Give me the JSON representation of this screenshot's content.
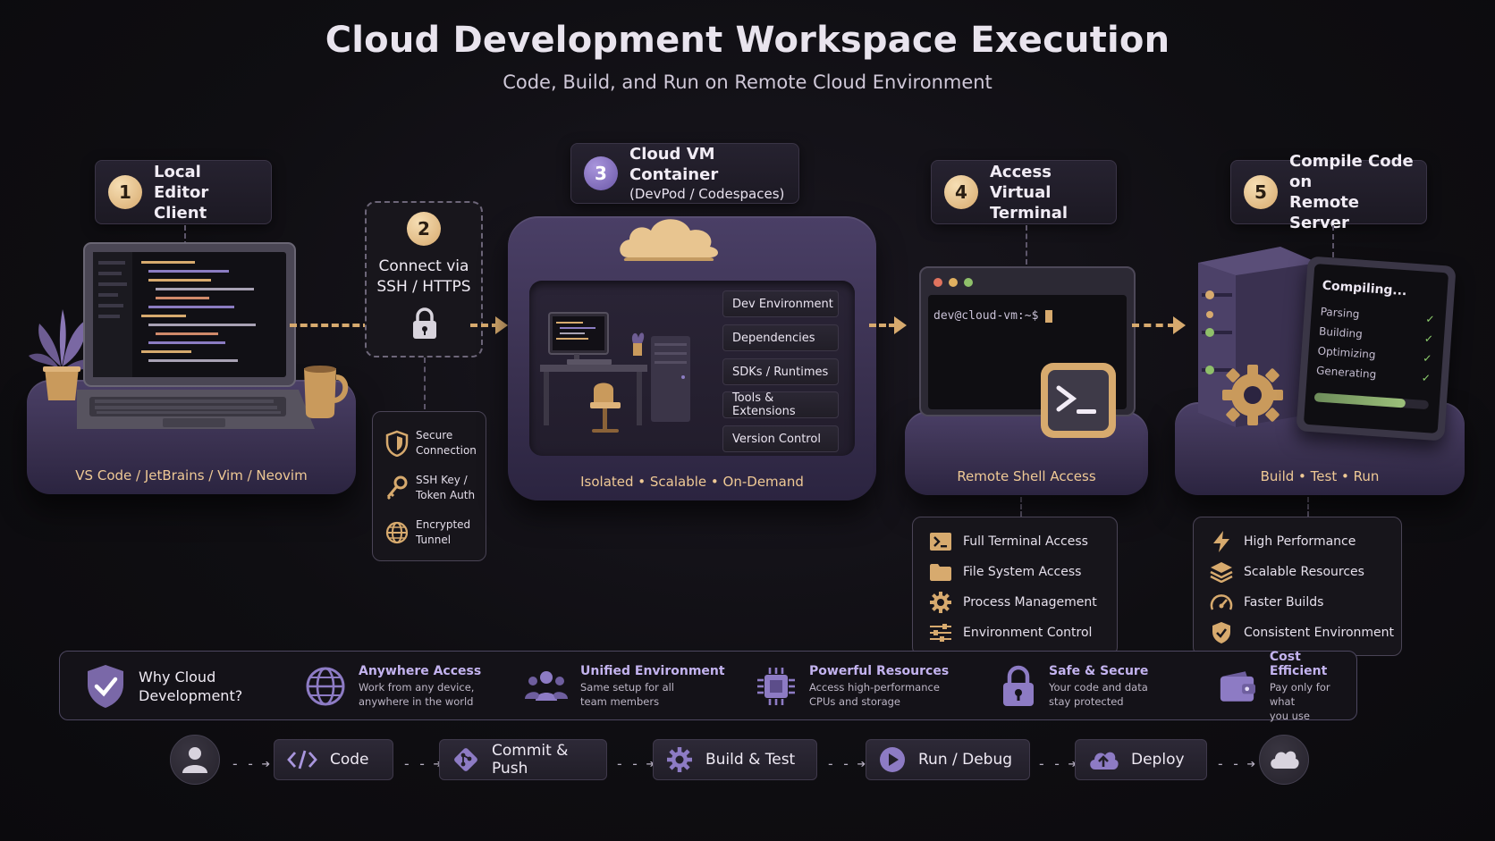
{
  "header": {
    "title": "Cloud Development Workspace Execution",
    "subtitle": "Code, Build, and Run on Remote Cloud Environment"
  },
  "steps": {
    "s1": {
      "num": "1",
      "line1": "Local Editor",
      "line2": "Client",
      "platform_label": "VS Code / JetBrains / Vim / Neovim"
    },
    "s2": {
      "num": "2",
      "line1": "Connect via",
      "line2": "SSH / HTTPS"
    },
    "s3": {
      "num": "3",
      "line1": "Cloud VM Container",
      "line2": "(DevPod / Codespaces)",
      "platform_label": "Isolated  •  Scalable  •  On-Demand",
      "env_items": [
        "Dev Environment",
        "Dependencies",
        "SDKs / Runtimes",
        "Tools & Extensions",
        "Version Control"
      ]
    },
    "s4": {
      "num": "4",
      "line1": "Access Virtual",
      "line2": "Terminal",
      "platform_label": "Remote Shell Access",
      "prompt": "dev@cloud-vm:~$"
    },
    "s5": {
      "num": "5",
      "line1": "Compile Code on",
      "line2": "Remote Server",
      "platform_label": "Build  •  Test  •  Run",
      "compile_title": "Compiling...",
      "compile_steps": [
        "Parsing",
        "Building",
        "Optimizing",
        "Generating"
      ],
      "progress": 0.8
    }
  },
  "security": {
    "items": [
      {
        "line1": "Secure",
        "line2": "Connection",
        "icon": "shield-icon"
      },
      {
        "line1": "SSH Key /",
        "line2": "Token Auth",
        "icon": "key-icon"
      },
      {
        "line1": "Encrypted",
        "line2": "Tunnel",
        "icon": "globe-icon"
      }
    ]
  },
  "terminal_features": [
    {
      "label": "Full Terminal Access",
      "icon": "terminal-icon"
    },
    {
      "label": "File System Access",
      "icon": "folder-icon"
    },
    {
      "label": "Process Management",
      "icon": "gear-icon"
    },
    {
      "label": "Environment Control",
      "icon": "sliders-icon"
    }
  ],
  "server_features": [
    {
      "label": "High Performance",
      "icon": "lightning-icon"
    },
    {
      "label": "Scalable Resources",
      "icon": "layers-icon"
    },
    {
      "label": "Faster Builds",
      "icon": "gauge-icon"
    },
    {
      "label": "Consistent Environment",
      "icon": "shield-check-icon"
    }
  ],
  "why": {
    "title_line1": "Why Cloud",
    "title_line2": "Development?",
    "items": [
      {
        "title": "Anywhere Access",
        "line1": "Work from any device,",
        "line2": "anywhere in the world",
        "icon": "globe-icon"
      },
      {
        "title": "Unified Environment",
        "line1": "Same setup for all",
        "line2": "team members",
        "icon": "users-icon"
      },
      {
        "title": "Powerful Resources",
        "line1": "Access high-performance",
        "line2": "CPUs and storage",
        "icon": "chip-icon"
      },
      {
        "title": "Safe & Secure",
        "line1": "Your code and data",
        "line2": "stay protected",
        "icon": "lock-icon"
      },
      {
        "title": "Cost Efficient",
        "line1": "Pay only for what",
        "line2": "you use",
        "icon": "wallet-icon"
      }
    ]
  },
  "workflow": {
    "arrow": "- - ➔",
    "steps": [
      {
        "label": "Code",
        "icon": "code-icon"
      },
      {
        "label": "Commit & Push",
        "icon": "git-icon"
      },
      {
        "label": "Build & Test",
        "icon": "gear-icon"
      },
      {
        "label": "Run / Debug",
        "icon": "play-icon"
      },
      {
        "label": "Deploy",
        "icon": "upload-cloud-icon"
      }
    ]
  },
  "colors": {
    "accent_gold": "#d7aa6e",
    "accent_purple": "#6b58a8",
    "check_green": "#8fd06e"
  }
}
